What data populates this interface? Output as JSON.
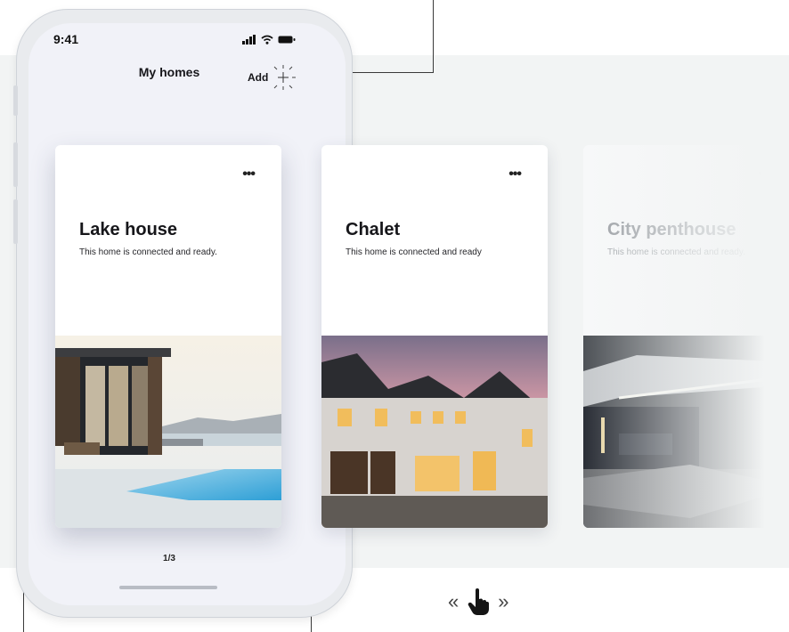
{
  "status_bar": {
    "time": "9:41"
  },
  "header": {
    "title": "My homes",
    "add_label": "Add"
  },
  "cards": [
    {
      "title": "Lake house",
      "subtitle": "This home is connected and ready.",
      "menu": "•••"
    },
    {
      "title": "Chalet",
      "subtitle": "This home is connected and ready",
      "menu": "•••"
    },
    {
      "title": "City penthouse",
      "subtitle": "This home is connected and ready.",
      "menu": "•••"
    }
  ],
  "pager": {
    "label": "1/3"
  },
  "swipe_hint": {
    "left": "«",
    "right": "»",
    "icon": "hand-pointer-icon"
  },
  "colors": {
    "background_band": "#f2f4f4",
    "phone_body": "#f1f2f8",
    "text": "#16161a"
  }
}
